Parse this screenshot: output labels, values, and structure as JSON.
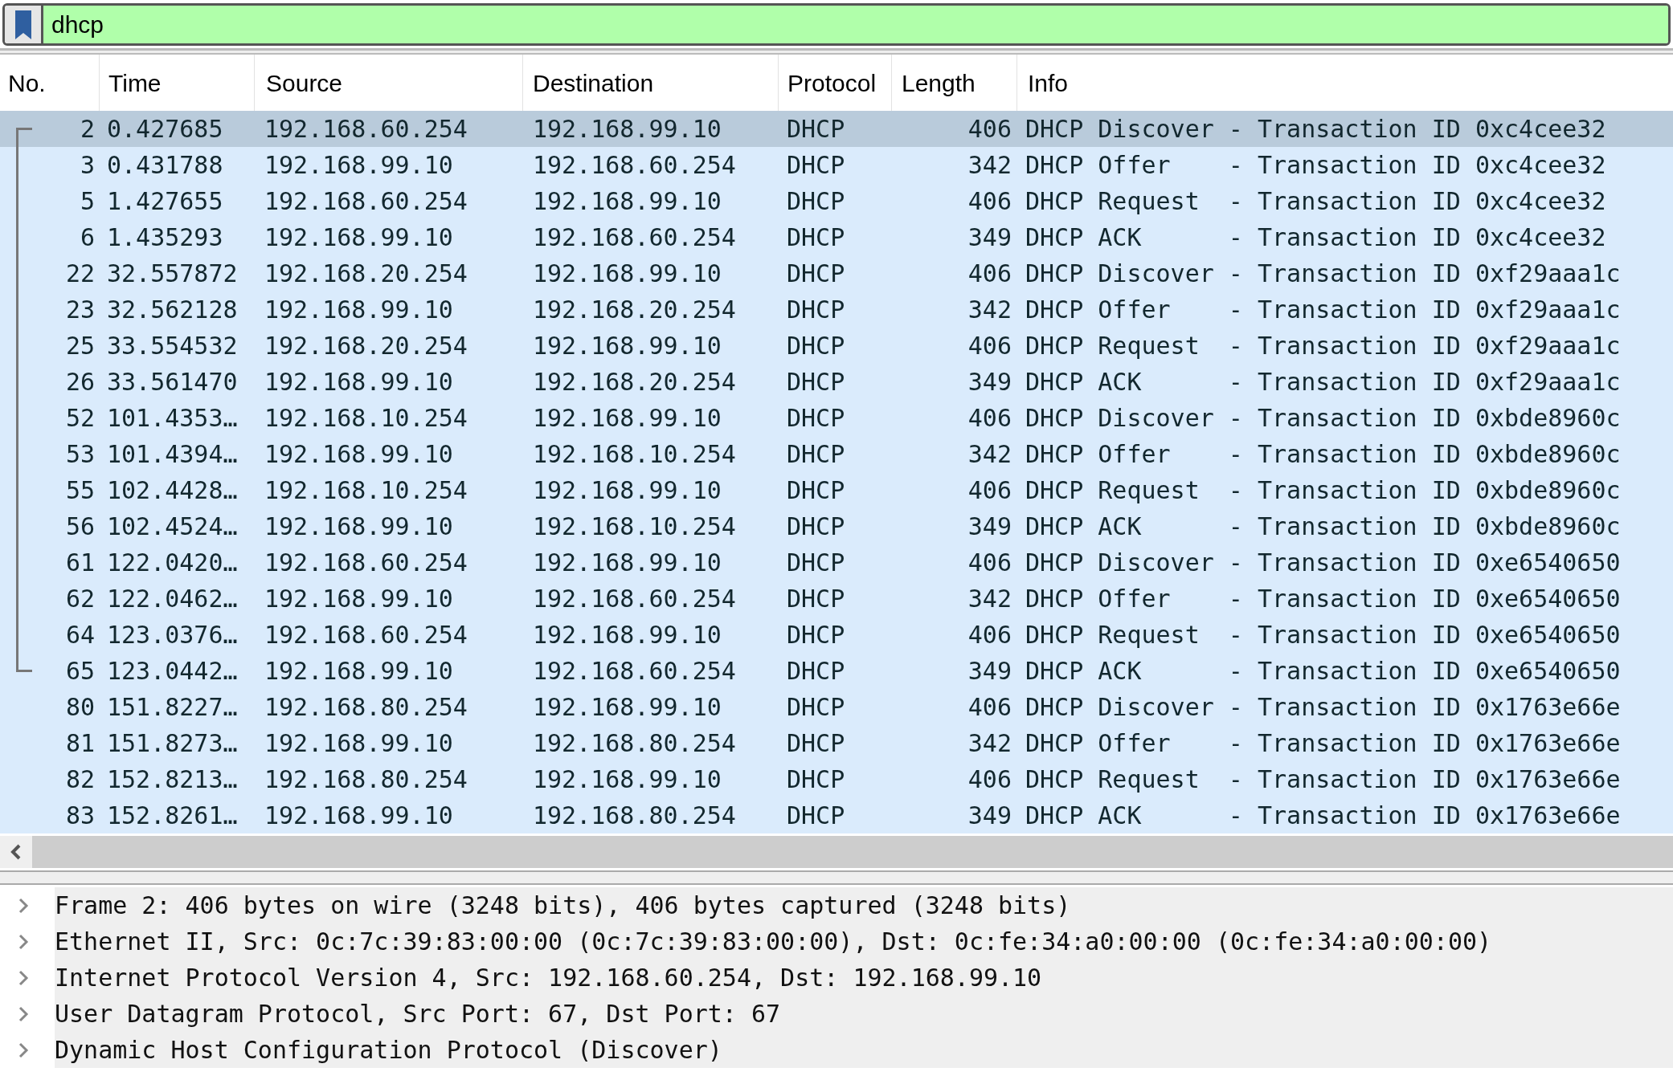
{
  "filter": {
    "value": "dhcp"
  },
  "columns": [
    "No.",
    "Time",
    "Source",
    "Destination",
    "Protocol",
    "Length",
    "Info"
  ],
  "rows": [
    {
      "no": "2",
      "time": "0.427685",
      "source": "192.168.60.254",
      "destination": "192.168.99.10",
      "protocol": "DHCP",
      "length": "406",
      "info": "DHCP Discover - Transaction ID 0xc4cee32",
      "selected": true,
      "related": true
    },
    {
      "no": "3",
      "time": "0.431788",
      "source": "192.168.99.10",
      "destination": "192.168.60.254",
      "protocol": "DHCP",
      "length": "342",
      "info": "DHCP Offer    - Transaction ID 0xc4cee32",
      "selected": false,
      "related": true
    },
    {
      "no": "5",
      "time": "1.427655",
      "source": "192.168.60.254",
      "destination": "192.168.99.10",
      "protocol": "DHCP",
      "length": "406",
      "info": "DHCP Request  - Transaction ID 0xc4cee32",
      "selected": false,
      "related": true
    },
    {
      "no": "6",
      "time": "1.435293",
      "source": "192.168.99.10",
      "destination": "192.168.60.254",
      "protocol": "DHCP",
      "length": "349",
      "info": "DHCP ACK      - Transaction ID 0xc4cee32",
      "selected": false,
      "related": true
    },
    {
      "no": "22",
      "time": "32.557872",
      "source": "192.168.20.254",
      "destination": "192.168.99.10",
      "protocol": "DHCP",
      "length": "406",
      "info": "DHCP Discover - Transaction ID 0xf29aaa1c",
      "selected": false,
      "related": true
    },
    {
      "no": "23",
      "time": "32.562128",
      "source": "192.168.99.10",
      "destination": "192.168.20.254",
      "protocol": "DHCP",
      "length": "342",
      "info": "DHCP Offer    - Transaction ID 0xf29aaa1c",
      "selected": false,
      "related": true
    },
    {
      "no": "25",
      "time": "33.554532",
      "source": "192.168.20.254",
      "destination": "192.168.99.10",
      "protocol": "DHCP",
      "length": "406",
      "info": "DHCP Request  - Transaction ID 0xf29aaa1c",
      "selected": false,
      "related": true
    },
    {
      "no": "26",
      "time": "33.561470",
      "source": "192.168.99.10",
      "destination": "192.168.20.254",
      "protocol": "DHCP",
      "length": "349",
      "info": "DHCP ACK      - Transaction ID 0xf29aaa1c",
      "selected": false,
      "related": true
    },
    {
      "no": "52",
      "time": "101.4353…",
      "source": "192.168.10.254",
      "destination": "192.168.99.10",
      "protocol": "DHCP",
      "length": "406",
      "info": "DHCP Discover - Transaction ID 0xbde8960c",
      "selected": false,
      "related": true
    },
    {
      "no": "53",
      "time": "101.4394…",
      "source": "192.168.99.10",
      "destination": "192.168.10.254",
      "protocol": "DHCP",
      "length": "342",
      "info": "DHCP Offer    - Transaction ID 0xbde8960c",
      "selected": false,
      "related": true
    },
    {
      "no": "55",
      "time": "102.4428…",
      "source": "192.168.10.254",
      "destination": "192.168.99.10",
      "protocol": "DHCP",
      "length": "406",
      "info": "DHCP Request  - Transaction ID 0xbde8960c",
      "selected": false,
      "related": true
    },
    {
      "no": "56",
      "time": "102.4524…",
      "source": "192.168.99.10",
      "destination": "192.168.10.254",
      "protocol": "DHCP",
      "length": "349",
      "info": "DHCP ACK      - Transaction ID 0xbde8960c",
      "selected": false,
      "related": true
    },
    {
      "no": "61",
      "time": "122.0420…",
      "source": "192.168.60.254",
      "destination": "192.168.99.10",
      "protocol": "DHCP",
      "length": "406",
      "info": "DHCP Discover - Transaction ID 0xe6540650",
      "selected": false,
      "related": true
    },
    {
      "no": "62",
      "time": "122.0462…",
      "source": "192.168.99.10",
      "destination": "192.168.60.254",
      "protocol": "DHCP",
      "length": "342",
      "info": "DHCP Offer    - Transaction ID 0xe6540650",
      "selected": false,
      "related": true
    },
    {
      "no": "64",
      "time": "123.0376…",
      "source": "192.168.60.254",
      "destination": "192.168.99.10",
      "protocol": "DHCP",
      "length": "406",
      "info": "DHCP Request  - Transaction ID 0xe6540650",
      "selected": false,
      "related": true
    },
    {
      "no": "65",
      "time": "123.0442…",
      "source": "192.168.99.10",
      "destination": "192.168.60.254",
      "protocol": "DHCP",
      "length": "349",
      "info": "DHCP ACK      - Transaction ID 0xe6540650",
      "selected": false,
      "related": true
    },
    {
      "no": "80",
      "time": "151.8227…",
      "source": "192.168.80.254",
      "destination": "192.168.99.10",
      "protocol": "DHCP",
      "length": "406",
      "info": "DHCP Discover - Transaction ID 0x1763e66e",
      "selected": false,
      "related": false
    },
    {
      "no": "81",
      "time": "151.8273…",
      "source": "192.168.99.10",
      "destination": "192.168.80.254",
      "protocol": "DHCP",
      "length": "342",
      "info": "DHCP Offer    - Transaction ID 0x1763e66e",
      "selected": false,
      "related": false
    },
    {
      "no": "82",
      "time": "152.8213…",
      "source": "192.168.80.254",
      "destination": "192.168.99.10",
      "protocol": "DHCP",
      "length": "406",
      "info": "DHCP Request  - Transaction ID 0x1763e66e",
      "selected": false,
      "related": false
    },
    {
      "no": "83",
      "time": "152.8261…",
      "source": "192.168.99.10",
      "destination": "192.168.80.254",
      "protocol": "DHCP",
      "length": "349",
      "info": "DHCP ACK      - Transaction ID 0x1763e66e",
      "selected": false,
      "related": false
    }
  ],
  "details": [
    {
      "text": "Frame 2: 406 bytes on wire (3248 bits), 406 bytes captured (3248 bits)",
      "expanded": false
    },
    {
      "text": "Ethernet II, Src: 0c:7c:39:83:00:00 (0c:7c:39:83:00:00), Dst: 0c:fe:34:a0:00:00 (0c:fe:34:a0:00:00)",
      "expanded": false
    },
    {
      "text": "Internet Protocol Version 4, Src: 192.168.60.254, Dst: 192.168.99.10",
      "expanded": false
    },
    {
      "text": "User Datagram Protocol, Src Port: 67, Dst Port: 67",
      "expanded": false
    },
    {
      "text": "Dynamic Host Configuration Protocol (Discover)",
      "expanded": false
    }
  ]
}
